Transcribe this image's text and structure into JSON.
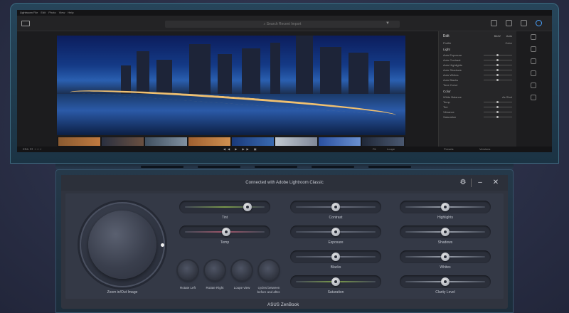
{
  "lightroom": {
    "app_title": "Lightroom",
    "menu": [
      "File",
      "Edit",
      "Photo",
      "View",
      "Help"
    ],
    "search_placeholder": "Search Recent Import",
    "edit_header": "Edit",
    "auto_button": "Auto",
    "bw_button": "B&W",
    "profile_label": "Profile",
    "profile_value": "Color",
    "light_section": "Light",
    "light_rows": [
      "Auto Exposure",
      "Auto Contrast",
      "Auto Highlights",
      "Auto Shadows",
      "Auto Whites",
      "Auto Blacks"
    ],
    "tone_curve": "Tone Curve",
    "color_section": "Color",
    "wb_label": "White Balance",
    "wb_value": "As Shot",
    "color_rows": [
      "Temp",
      "Tint",
      "Vibrance",
      "Saturation"
    ],
    "bottom_left": [
      "ERA",
      "ⵏⵏⵏ",
      "☆☆☆"
    ],
    "bottom_right": [
      "Fit",
      "Loupe",
      "Presets",
      "Versions"
    ],
    "accent": "#4aa3ff"
  },
  "screenpad": {
    "header_title": "Connected with Adobe Lightroom Classic",
    "dial_label": "Zoom in/Out Image",
    "round_buttons": [
      {
        "label": "Rotate Left"
      },
      {
        "label": "Rotate Right"
      },
      {
        "label": "Loupe view"
      },
      {
        "label": "cycles between before and after."
      }
    ],
    "sliders": [
      {
        "label": "Tint",
        "level": 0.8,
        "track": "#7a9a4a"
      },
      {
        "label": "Contrast",
        "level": 0.5,
        "track": "#6d7280"
      },
      {
        "label": "Highlights",
        "level": 0.5,
        "track": "#9aa0ab"
      },
      {
        "label": "Temp",
        "level": 0.52,
        "track": "#a0566a"
      },
      {
        "label": "Exposure",
        "level": 0.5,
        "track": "#6d7280"
      },
      {
        "label": "Shadows",
        "level": 0.5,
        "track": "#9aa0ab"
      },
      {
        "label": "Blacks",
        "level": 0.5,
        "track": "#6d7280"
      },
      {
        "label": "Whites",
        "level": 0.5,
        "track": "#9aa0ab"
      },
      {
        "label": "Saturation",
        "level": 0.5,
        "track": "#7a9a4a"
      },
      {
        "label": "Clarity Level",
        "level": 0.5,
        "track": "#9aa0ab"
      }
    ]
  },
  "brand": "ASUS ZenBook"
}
